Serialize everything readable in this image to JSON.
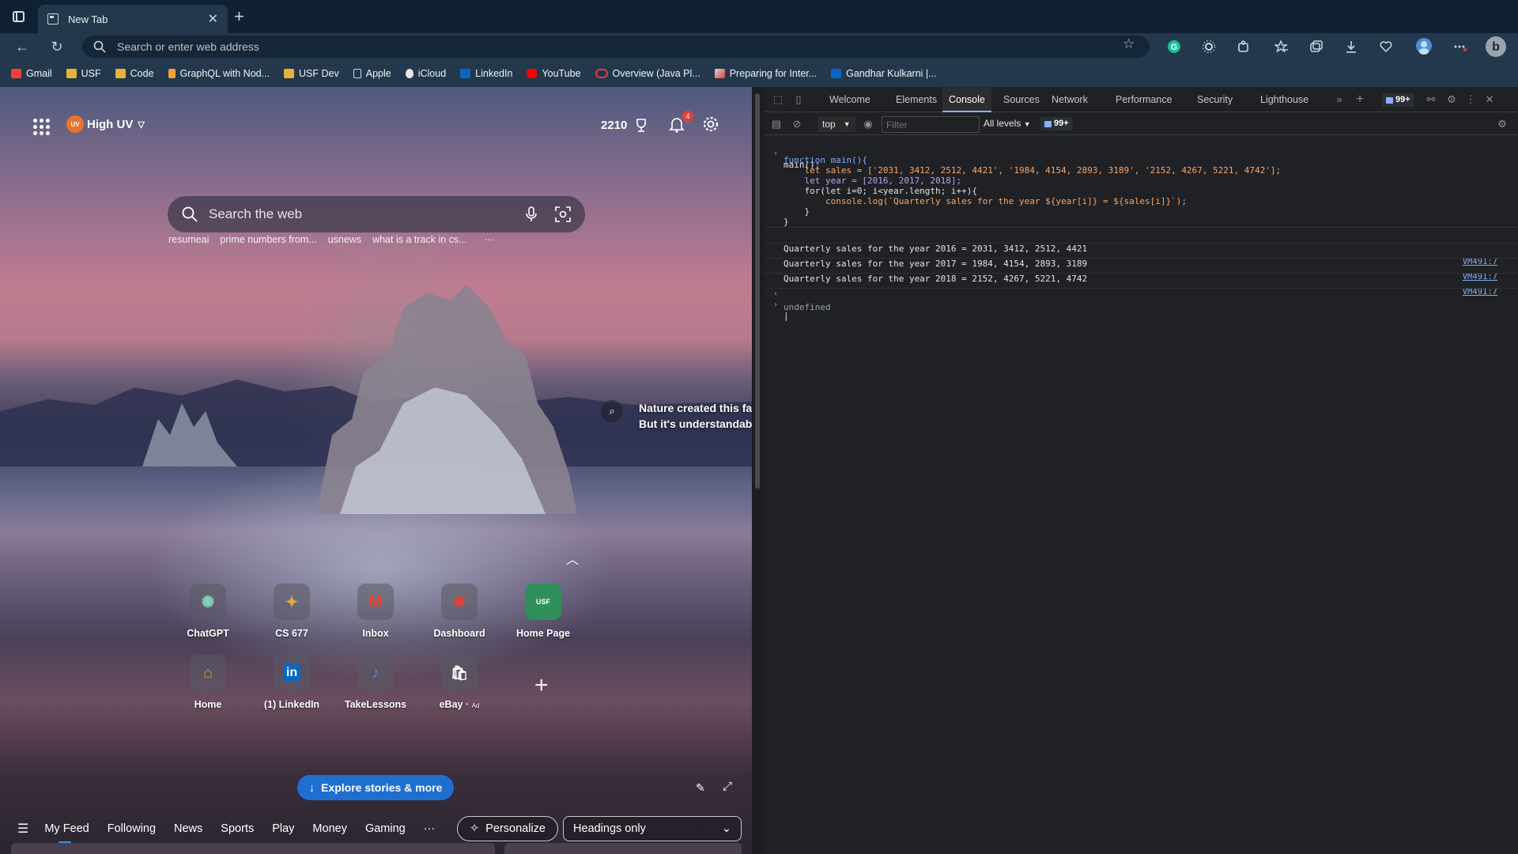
{
  "browser": {
    "tab_title": "New Tab",
    "address_placeholder": "Search or enter web address",
    "bookmarks": [
      {
        "label": "Gmail",
        "icon": "gmail-icon",
        "color": "#ea4335"
      },
      {
        "label": "USF",
        "icon": "folder-icon",
        "color": "#e8b33c"
      },
      {
        "label": "Code",
        "icon": "folder-icon",
        "color": "#e8b33c"
      },
      {
        "label": "GraphQL with Nod...",
        "icon": "bookmark-flag-icon",
        "color": "#f3a13b"
      },
      {
        "label": "USF Dev",
        "icon": "folder-icon",
        "color": "#e8b33c"
      },
      {
        "label": "Apple",
        "icon": "page-icon",
        "color": "#cfd6de"
      },
      {
        "label": "iCloud",
        "icon": "apple-icon",
        "color": "#e6e6e6"
      },
      {
        "label": "LinkedIn",
        "icon": "linkedin-icon",
        "color": "#0a66c2"
      },
      {
        "label": "YouTube",
        "icon": "youtube-icon",
        "color": "#ff0000"
      },
      {
        "label": "Overview (Java Pl...",
        "icon": "oracle-icon",
        "color": "#e0403a"
      },
      {
        "label": "Preparing for Inter...",
        "icon": "rocket-icon",
        "color": "#cfd6de"
      },
      {
        "label": "Gandhar Kulkarni |...",
        "icon": "linkedin-icon",
        "color": "#0a66c2"
      }
    ]
  },
  "ntp": {
    "weather_label": "High UV",
    "weather_badge": "UV",
    "rewards_points": "2210",
    "notifications_count": "4",
    "search_placeholder": "Search the web",
    "trending": [
      "resumeai",
      "prime numbers from...",
      "usnews",
      "what is a track in cs...",
      "···"
    ],
    "caption_line1": "Nature created this fan",
    "caption_line2": "But it's understandable",
    "tiles": [
      {
        "label": "ChatGPT",
        "icon": "chatgpt-icon",
        "glyph": "✺",
        "color": "#7fd1b9"
      },
      {
        "label": "CS 677",
        "icon": "cs677-icon",
        "glyph": "✦",
        "color": "#e8a63a"
      },
      {
        "label": "Inbox",
        "icon": "gmail-icon",
        "glyph": "M",
        "color": "#ea4335"
      },
      {
        "label": "Dashboard",
        "icon": "dashboard-icon",
        "glyph": "✹",
        "color": "#e0403a"
      },
      {
        "label": "Home Page",
        "icon": "usf-icon",
        "glyph": "USF",
        "color": "#2f8f5a"
      },
      {
        "label": "Home",
        "icon": "home-icon",
        "glyph": "⌂",
        "color": "#f08c2a"
      },
      {
        "label": "(1) LinkedIn",
        "icon": "linkedin-icon",
        "glyph": "in",
        "color": "#0a66c2"
      },
      {
        "label": "TakeLessons",
        "icon": "takelessons-icon",
        "glyph": "♪",
        "color": "#3f8ee8"
      },
      {
        "label": "eBay",
        "ad": "Ad",
        "icon": "ebay-icon",
        "glyph": "🛍",
        "color": "#e6e6e6"
      }
    ],
    "explore_label": "Explore stories & more",
    "feed_tabs": [
      "My Feed",
      "Following",
      "News",
      "Sports",
      "Play",
      "Money",
      "Gaming",
      "···"
    ],
    "personalize_label": "Personalize",
    "headings_select_value": "Headings only"
  },
  "devtools": {
    "tabs": [
      "Welcome",
      "Elements",
      "Console",
      "Sources",
      "Network",
      "Performance",
      "Security",
      "Lighthouse"
    ],
    "active_tab": "Console",
    "issues_count": "99+",
    "context": "top",
    "filter_placeholder": "Filter",
    "levels": "All levels",
    "console": {
      "call": "main();",
      "code_lines": [
        "function main(){",
        "    let sales = ['2031, 3412, 2512, 4421', '1984, 4154, 2893, 3189', '2152, 4267, 5221, 4742'];",
        "    let year = [2016, 2017, 2018];",
        "    for(let i=0; i<year.length; i++){",
        "        console.log(`Quarterly sales for the year ${year[i]} = ${sales[i]}`);",
        "    }",
        "}"
      ],
      "logs": [
        {
          "text": "Quarterly sales for the year 2016 = 2031, 3412, 2512, 4421",
          "source": "VM491:7"
        },
        {
          "text": "Quarterly sales for the year 2017 = 1984, 4154, 2893, 3189",
          "source": "VM491:7"
        },
        {
          "text": "Quarterly sales for the year 2018 = 2152, 4267, 5221, 4742",
          "source": "VM491:7"
        }
      ],
      "return_value": "undefined"
    }
  }
}
